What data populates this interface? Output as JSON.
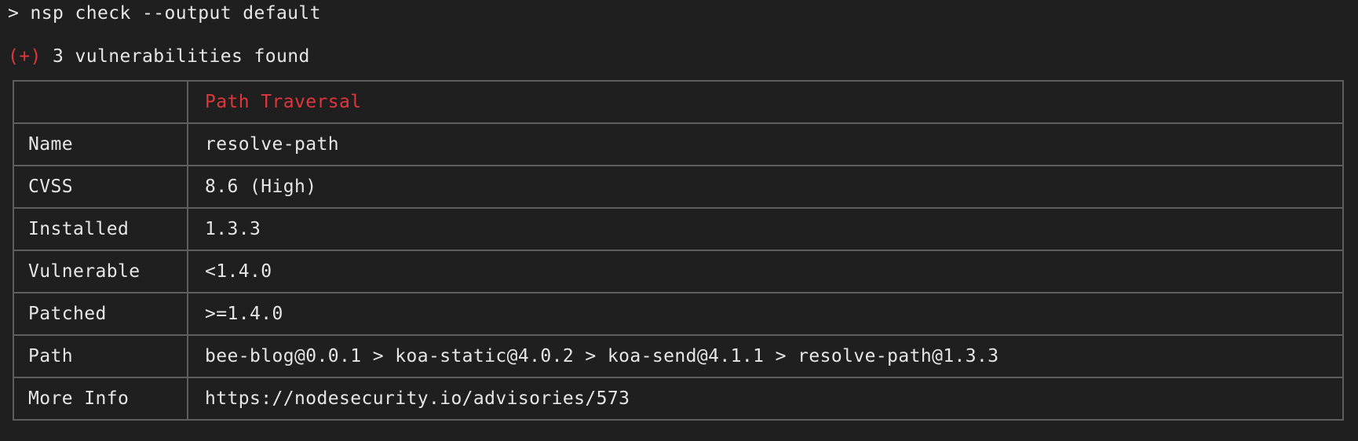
{
  "terminal": {
    "prompt_symbol": ">",
    "command": "nsp check --output default",
    "summary_marker": "(+)",
    "summary_text": "3 vulnerabilities found"
  },
  "advisory": {
    "title": "Path Traversal",
    "rows": [
      {
        "key": "Name",
        "value": "resolve-path"
      },
      {
        "key": "CVSS",
        "value": "8.6 (High)"
      },
      {
        "key": "Installed",
        "value": "1.3.3"
      },
      {
        "key": "Vulnerable",
        "value": "<1.4.0"
      },
      {
        "key": "Patched",
        "value": ">=1.4.0"
      },
      {
        "key": "Path",
        "value": "bee-blog@0.0.1 > koa-static@4.0.2 > koa-send@4.1.1 > resolve-path@1.3.3"
      },
      {
        "key": "More Info",
        "value": "https://nodesecurity.io/advisories/573"
      }
    ]
  },
  "colors": {
    "background": "#1f1f1f",
    "text": "#e6e6e6",
    "accent_red": "#e0363b",
    "border": "#5e5e5e"
  }
}
